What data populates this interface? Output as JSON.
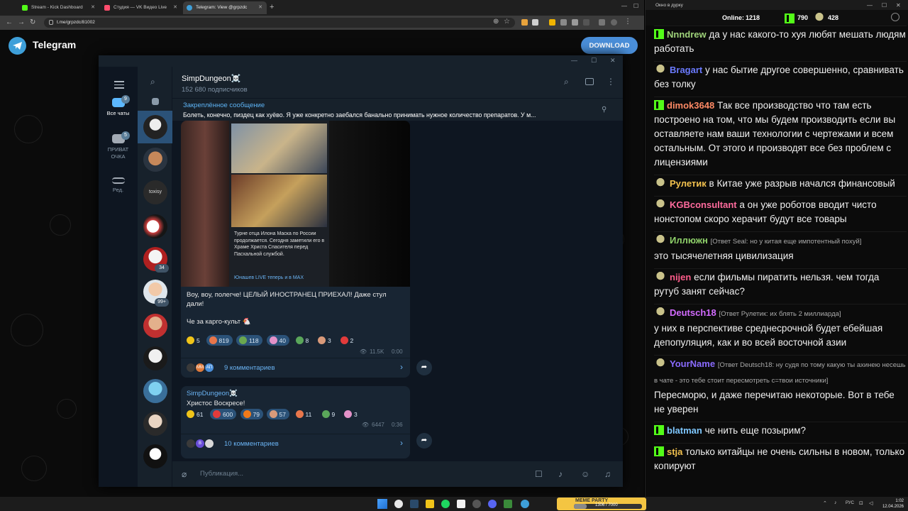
{
  "browser": {
    "tabs": [
      {
        "title": "Stream - Kick Dashboard",
        "color": "#53fc18"
      },
      {
        "title": "Студия — VK Видео Live",
        "color": "#ff4d6d"
      },
      {
        "title": "Telegram: View @grpzdc",
        "color": "#3e9fd9"
      }
    ],
    "url": "t.me/grpzdc/81002"
  },
  "telegram_page": {
    "brand": "Telegram",
    "download_label": "DOWNLOAD"
  },
  "tg": {
    "folders": [
      {
        "label": "Все чаты",
        "badge": "9"
      },
      {
        "label": "ПРИВАТ ОЧКА",
        "badge": "5"
      },
      {
        "label": "Ред."
      }
    ],
    "avatar_badges": [
      "34",
      "99+"
    ],
    "avatar_text": "toxisy",
    "channel": {
      "title": "SimpDungeon☠️",
      "subscribers": "152 680 подписчиков"
    },
    "pinned": {
      "label": "Закреплённое сообщение",
      "text": "Болеть, конечно, пиздец как хуёво. Я уже конкретно заебался банально принимать нужное количество препаратов. У м..."
    },
    "post1": {
      "image_caption": "Турне отца Илона Маска по России продолжается. Сегодня заметили его в Храме Христа Спасителя перед Пасхальной службой.",
      "image_footer": "Юнашев LIVE теперь и в MAX",
      "text1": "Воу, воу, полегче! ЦЕЛЫЙ ИНОСТРАНЕЦ ПРИЕХАЛ! Даже стул дали!",
      "text2": "Че за карго-культ 🐔",
      "reactions": [
        {
          "count": "5",
          "color": "#f0c419"
        },
        {
          "count": "819",
          "color": "#e8764b"
        },
        {
          "count": "118",
          "color": "#6aa84f"
        },
        {
          "count": "40",
          "color": "#e391c8"
        },
        {
          "count": "8",
          "color": "#5aa65a"
        },
        {
          "count": "3",
          "color": "#d99a7a"
        },
        {
          "count": "2",
          "color": "#e23b3b"
        }
      ],
      "views": "11.5K",
      "time": "0:00",
      "comments": "9 комментариев",
      "mini_avatars": [
        "ММ",
        "АП"
      ]
    },
    "post2": {
      "author": "SimpDungeon☠️",
      "text": "Христос Воскресе!",
      "reactions": [
        {
          "count": "61",
          "color": "#f0c419"
        },
        {
          "count": "600",
          "color": "#e23b3b"
        },
        {
          "count": "79",
          "color": "#f07a1a"
        },
        {
          "count": "57",
          "color": "#d99a7a"
        },
        {
          "count": "11",
          "color": "#e8764b"
        },
        {
          "count": "9",
          "color": "#5aa65a"
        },
        {
          "count": "3",
          "color": "#e391c8"
        }
      ],
      "views": "6447",
      "time": "0:36",
      "comments": "10 комментариев",
      "mini_avatars": [
        "В"
      ]
    },
    "composer_placeholder": "Публикация..."
  },
  "stream_chat": {
    "window_title": "Окно в дурку",
    "online_label": "Online:",
    "online_count": "1218",
    "kick_count": "790",
    "vk_count": "428",
    "messages": [
      {
        "badge": "kick",
        "user": "Nnndrew",
        "color": "#9fd37a",
        "text": "да у нас какого-то хуя любят мешать людям работать"
      },
      {
        "badge": "vk",
        "user": "Bragart",
        "color": "#6b7bff",
        "text": "у нас бытие другое совершенно, сравнивать без толку"
      },
      {
        "badge": "kick",
        "user": "dimok3648",
        "color": "#ff8a65",
        "text": "Так все производство что там есть построено на том, что мы будем производить если вы оставляете нам ваши технологии с чертежами и всем остальным. От этого и производят все без проблем с лицензиями"
      },
      {
        "badge": "vk",
        "user": "Рулетик",
        "color": "#f2c14e",
        "text": "в Китае уже разрыв начался финансовый"
      },
      {
        "badge": "vk",
        "user": "KGBconsultant",
        "color": "#ff6b9d",
        "text": "а он уже роботов вводит чисто нонстопом скоро херачит будут все товары"
      },
      {
        "badge": "vk",
        "user": "Иллюжн",
        "color": "#8fd16a",
        "reply": "[Ответ Seal: но у китая еще импотентный похуй]",
        "text": "это тысячелетняя цивилизация"
      },
      {
        "badge": "vk",
        "user": "nijen",
        "color": "#ff5c8a",
        "text": "если фильмы пиратить нельзя. чем тогда рутуб занят сейчас?"
      },
      {
        "badge": "vk",
        "user": "Deutsch18",
        "color": "#d26bff",
        "reply": "[Ответ Рулетик: их блять 2 миллиарда]",
        "text": "у них в перспективе среднесрочной будет ебейшая депопуляция, как и во всей восточной азии"
      },
      {
        "badge": "vk",
        "user": "YourName",
        "color": "#8a6bff",
        "reply": "[Ответ Deutsch18: ну судя по тому какую ты ахинею несешь в чате - это тебе стоит пересмотреть с=твои источники]",
        "text": "Пересморю, и даже перечитаю некоторые. Вот в тебе не уверен"
      },
      {
        "badge": "kick",
        "user": "blatman",
        "color": "#7fc8ff",
        "text": "че нить еще позырим?"
      },
      {
        "badge": "kick",
        "user": "stja",
        "color": "#f2c14e",
        "text": "только китайцы не очень сильны в новом, только копируют"
      }
    ]
  },
  "taskbar": {
    "widget_title": "MEME PARTY",
    "widget_value": "1306 / 7000",
    "lang": "РУС",
    "time": "1:02",
    "date": "12.04.2026"
  }
}
